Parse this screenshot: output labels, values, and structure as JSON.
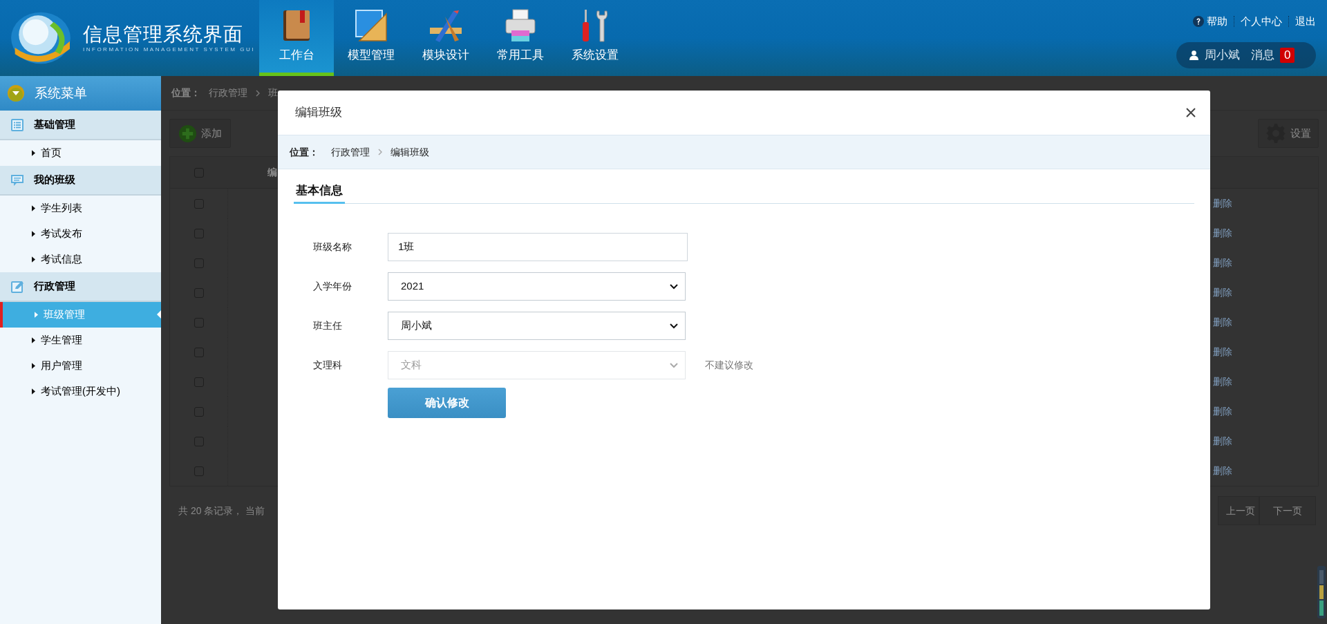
{
  "header": {
    "title": "信息管理系统界面",
    "subtitle": "INFORMATION MANAGEMENT SYSTEM GUI",
    "nav": [
      {
        "label": "工作台",
        "kind": "book",
        "selected": true
      },
      {
        "label": "模型管理",
        "kind": "ruler",
        "selected": false
      },
      {
        "label": "模块设计",
        "kind": "design",
        "selected": false
      },
      {
        "label": "常用工具",
        "kind": "printer",
        "selected": false
      },
      {
        "label": "系统设置",
        "kind": "tools",
        "selected": false
      }
    ],
    "links": [
      "帮助",
      "个人中心",
      "退出"
    ],
    "user": {
      "name": "周小斌",
      "messages_label": "消息",
      "messages_count": "0"
    }
  },
  "sidebar": {
    "title": "系统菜单",
    "groups": [
      {
        "label": "基础管理",
        "kind": "list",
        "items": [
          {
            "label": "首页",
            "selected": false
          }
        ]
      },
      {
        "label": "我的班级",
        "kind": "chat",
        "items": [
          {
            "label": "学生列表",
            "selected": false
          },
          {
            "label": "考试发布",
            "selected": false
          },
          {
            "label": "考试信息",
            "selected": false
          }
        ]
      },
      {
        "label": "行政管理",
        "kind": "edit",
        "items": [
          {
            "label": "班级管理",
            "selected": true
          },
          {
            "label": "学生管理",
            "selected": false
          },
          {
            "label": "用户管理",
            "selected": false
          },
          {
            "label": "考试管理(开发中)",
            "selected": false
          }
        ]
      }
    ]
  },
  "main": {
    "breadcrumb": {
      "label": "位置：",
      "path": [
        "行政管理",
        "班"
      ]
    },
    "add_button": "添加",
    "settings_button": "设置",
    "table": {
      "header_checked": false,
      "column_2": "编",
      "rows": [
        {
          "checked": false,
          "action": "删除"
        },
        {
          "checked": false,
          "action": "删除"
        },
        {
          "checked": false,
          "action": "删除"
        },
        {
          "checked": false,
          "action": "删除"
        },
        {
          "checked": false,
          "action": "删除"
        },
        {
          "checked": false,
          "action": "删除"
        },
        {
          "checked": false,
          "action": "删除"
        },
        {
          "checked": false,
          "action": "删除"
        },
        {
          "checked": false,
          "action": "删除"
        },
        {
          "checked": false,
          "action": "删除"
        }
      ]
    },
    "footer": "共 20 条记录， 当前",
    "pagination": [
      "上一页",
      "下一页"
    ]
  },
  "dialog": {
    "title": "编辑班级",
    "breadcrumb": {
      "label": "位置：",
      "path": [
        "行政管理",
        "编辑班级"
      ]
    },
    "tabs": [
      {
        "label": "基本信息",
        "selected": true
      }
    ],
    "fields": [
      {
        "label": "班级名称",
        "kind": "text",
        "value": "1班",
        "disabled": false
      },
      {
        "label": "入学年份",
        "kind": "select",
        "value": "2021",
        "disabled": false
      },
      {
        "label": "班主任",
        "kind": "select",
        "value": "周小斌",
        "disabled": false
      },
      {
        "label": "文理科",
        "kind": "select",
        "value": "文科",
        "disabled": true,
        "note": "不建议修改"
      }
    ],
    "submit": "确认修改"
  }
}
